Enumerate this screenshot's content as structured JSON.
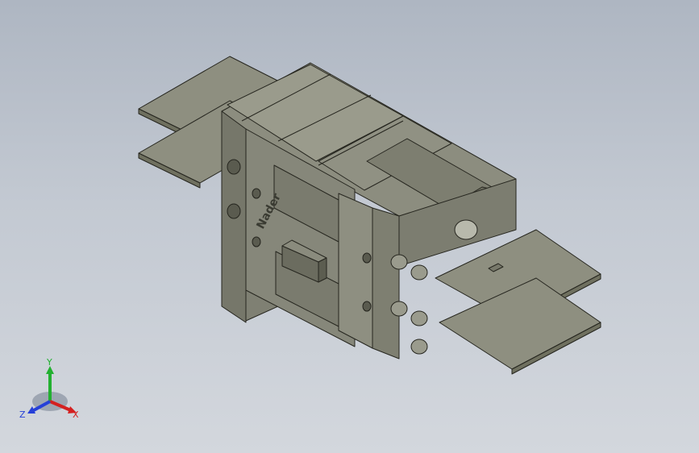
{
  "viewport": {
    "background_top": "#aeb6c2",
    "background_bottom": "#d3d7dd"
  },
  "model": {
    "body_color": "#8a8b7d",
    "edge_color": "#26261f",
    "brand_text": "Nader"
  },
  "triad": {
    "x_label": "X",
    "y_label": "Y",
    "z_label": "Z",
    "x_color": "#d42020",
    "y_color": "#22b030",
    "z_color": "#2640d8"
  }
}
